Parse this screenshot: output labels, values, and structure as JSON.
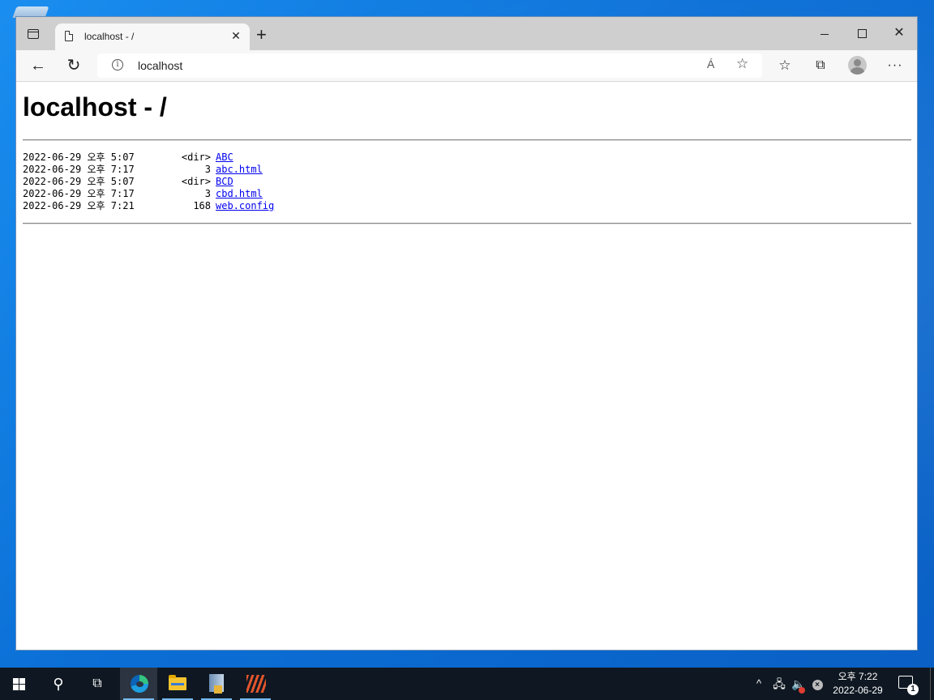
{
  "browser": {
    "tab_title": "localhost - /",
    "tab_close": "✕",
    "new_tab": "+",
    "address": "localhost",
    "info_glyph": "i",
    "read_aloud_glyph": "Á",
    "favorite_add_glyph": "☆",
    "favorites_glyph": "☆",
    "collections_glyph": "⧉",
    "more_glyph": "···",
    "back_glyph": "←",
    "refresh_glyph": "↻",
    "close_glyph": "✕"
  },
  "page": {
    "title": "localhost - /",
    "entries": [
      {
        "date": "2022-06-29 오후 5:07",
        "size": "<dir>",
        "name": "ABC"
      },
      {
        "date": "2022-06-29 오후 7:17",
        "size": "3",
        "name": "abc.html"
      },
      {
        "date": "2022-06-29 오후 5:07",
        "size": "<dir>",
        "name": "BCD"
      },
      {
        "date": "2022-06-29 오후 7:17",
        "size": "3",
        "name": "cbd.html"
      },
      {
        "date": "2022-06-29 오후 7:21",
        "size": "168",
        "name": "web.config"
      }
    ]
  },
  "taskbar": {
    "search_glyph": "⚲",
    "taskview_glyph": "⧉",
    "tray_chevron": "^",
    "tray_net_glyph": "🖧",
    "tray_vol_glyph": "🔈",
    "tray_err_glyph": "×",
    "clock_time": "오후 7:22",
    "clock_date": "2022-06-29",
    "notification_count": "1"
  }
}
